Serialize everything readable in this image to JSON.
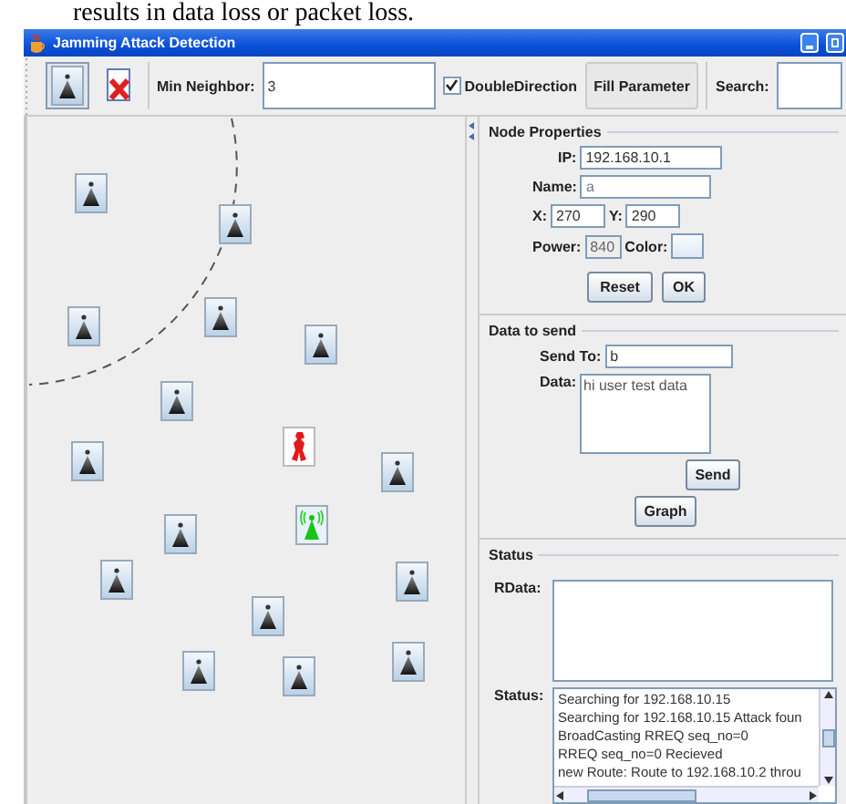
{
  "caption": "results in data loss or packet loss.",
  "window": {
    "title": "Jamming Attack Detection"
  },
  "toolbar": {
    "tools": [
      {
        "kind": "node",
        "selected": true
      },
      {
        "kind": "delete",
        "selected": false
      }
    ],
    "min_neighbor": {
      "label": "Min Neighbor:",
      "value": "3"
    },
    "double_direction": {
      "label": "DoubleDirection",
      "checked": true
    },
    "fill_button": "Fill Parameter",
    "search": {
      "label": "Search:"
    }
  },
  "network": {
    "nodes": [
      {
        "kind": "node"
      },
      {
        "kind": "node"
      },
      {
        "kind": "node"
      },
      {
        "kind": "node"
      },
      {
        "kind": "node"
      },
      {
        "kind": "node"
      },
      {
        "kind": "node"
      },
      {
        "kind": "attacker"
      },
      {
        "kind": "node"
      },
      {
        "kind": "node"
      },
      {
        "kind": "target"
      },
      {
        "kind": "node"
      },
      {
        "kind": "node"
      },
      {
        "kind": "node"
      },
      {
        "kind": "node"
      },
      {
        "kind": "node"
      },
      {
        "kind": "node"
      }
    ]
  },
  "node_properties": {
    "title": "Node Properties",
    "ip": {
      "label": "IP:",
      "value": "192.168.10.1"
    },
    "name": {
      "label": "Name:",
      "value": "a"
    },
    "x": {
      "label": "X:",
      "value": "270"
    },
    "y": {
      "label": "Y:",
      "value": "290"
    },
    "power": {
      "label": "Power:",
      "value": "840",
      "disabled": true
    },
    "color": {
      "label": "Color:"
    },
    "buttons": [
      "Reset",
      "OK"
    ]
  },
  "data_to_send": {
    "title": "Data to send",
    "send_to": {
      "label": "Send To:",
      "value": "b"
    },
    "data": {
      "label": "Data:",
      "value": "hi user test data"
    },
    "buttons": [
      "Send",
      "Graph"
    ]
  },
  "status": {
    "title": "Status",
    "rdata": {
      "label": "RData:"
    },
    "log": {
      "label": "Status:",
      "lines": [
        "Searching for 192.168.10.15",
        "Searching for 192.168.10.15 Attack foun",
        "BroadCasting RREQ seq_no=0",
        "RREQ seq_no=0 Recieved",
        "new Route: Route to 192.168.10.2 throu"
      ]
    }
  }
}
